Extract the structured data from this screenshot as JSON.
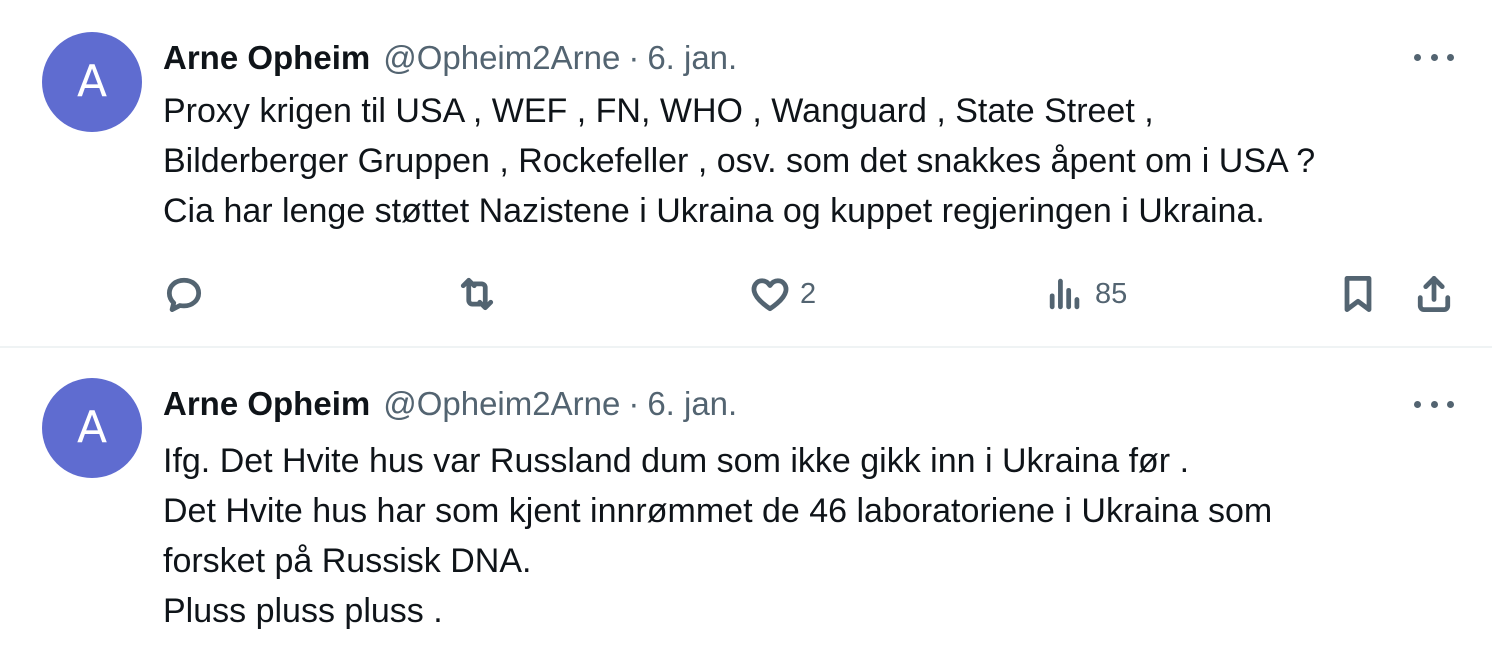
{
  "tweets": [
    {
      "avatar_letter": "A",
      "name": "Arne Opheim",
      "handle": "@Opheim2Arne",
      "separator": "·",
      "date": "6. jan.",
      "lines": [
        "Proxy krigen til USA , WEF , FN, WHO , Wanguard , State Street ,",
        "Bilderberger Gruppen , Rockefeller , osv. som det snakkes åpent om i USA ?",
        "Cia har lenge støttet Nazistene i Ukraina og kuppet regjeringen i Ukraina."
      ],
      "likes": "2",
      "views": "85",
      "icons": {
        "reply": "reply-icon",
        "retweet": "retweet-icon",
        "like": "heart-icon",
        "views": "views-icon",
        "bookmark": "bookmark-icon",
        "share": "share-icon",
        "more": "more-icon"
      }
    },
    {
      "avatar_letter": "A",
      "name": "Arne Opheim",
      "handle": "@Opheim2Arne",
      "separator": "·",
      "date": "6. jan.",
      "lines": [
        "Ifg. Det Hvite hus var Russland dum som ikke gikk inn i Ukraina før .",
        "Det Hvite hus har som kjent innrømmet de 46 laboratoriene i Ukraina som",
        "forsket på Russisk DNA.",
        "Pluss pluss pluss ."
      ]
    }
  ],
  "colors": {
    "avatar": "#5f6cd0",
    "text": "#0f1419",
    "secondary": "#536471",
    "divider": "#eff3f4"
  }
}
